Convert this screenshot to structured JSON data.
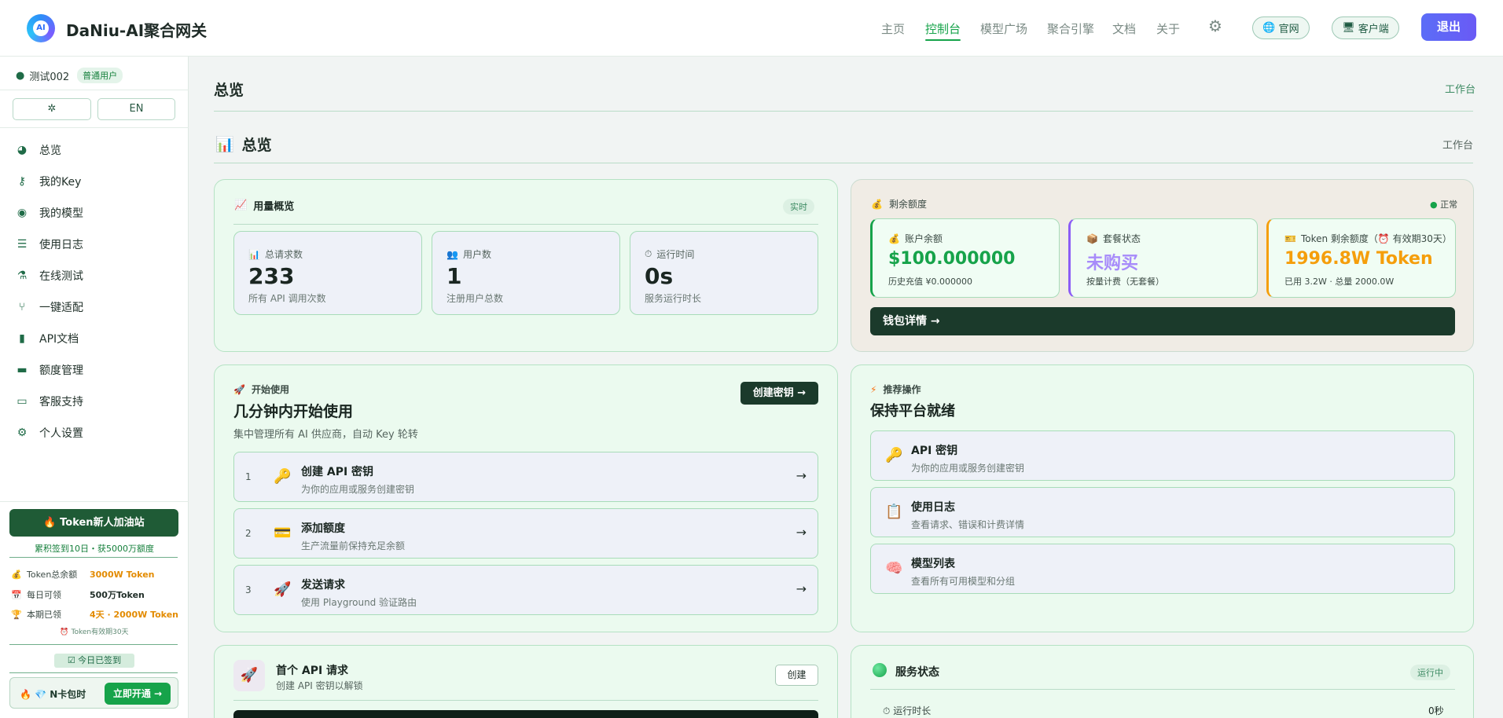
{
  "app": {
    "name": "DaNiu-AI聚合网关",
    "logo_text": "AI"
  },
  "nav": {
    "items": [
      {
        "label": "主页"
      },
      {
        "label": "控制台"
      },
      {
        "label": "模型广场"
      },
      {
        "label": "聚合引擎"
      },
      {
        "label": "文档"
      },
      {
        "label": "关于"
      }
    ],
    "active": "控制台",
    "official_site": "官网",
    "client": "客户端",
    "logout": "退出"
  },
  "sidebar": {
    "username": "测试002",
    "role_badge": "普通用户",
    "lang_button": "EN",
    "items": [
      {
        "label": "总览",
        "icon": "pie-chart-icon"
      },
      {
        "label": "我的Key",
        "icon": "key-icon"
      },
      {
        "label": "我的模型",
        "icon": "brain-icon"
      },
      {
        "label": "使用日志",
        "icon": "list-icon"
      },
      {
        "label": "在线测试",
        "icon": "flask-icon"
      },
      {
        "label": "一键适配",
        "icon": "branch-icon"
      },
      {
        "label": "API文档",
        "icon": "book-icon"
      },
      {
        "label": "额度管理",
        "icon": "wallet-icon"
      },
      {
        "label": "客服支持",
        "icon": "support-icon"
      },
      {
        "label": "个人设置",
        "icon": "gear-icon"
      }
    ],
    "promo": {
      "button": "Token新人加油站",
      "subtitle": "累积签到10日・获5000万额度",
      "rows": [
        {
          "key": "Token总余额",
          "value": "3000W Token",
          "color": "#e38b00"
        },
        {
          "key": "每日可领",
          "value": "500万Token",
          "color": "#1f2d27"
        },
        {
          "key": "本期已领",
          "value": "4天 · 2000W Token",
          "color": "#e38b00"
        }
      ],
      "note": "Token有效期30天",
      "checked_in": "今日已签到"
    },
    "ncard": {
      "label": "N卡包时",
      "button": "立即开通 →"
    }
  },
  "main": {
    "page_title": "总览",
    "breadcrumb": "工作台",
    "section_title": "总览",
    "section_breadcrumb": "工作台",
    "usage": {
      "title": "用量概览",
      "tag": "实时",
      "stats": [
        {
          "label": "总请求数",
          "value": "233",
          "sub": "所有 API 调用次数"
        },
        {
          "label": "用户数",
          "value": "1",
          "sub": "注册用户总数"
        },
        {
          "label": "运行时间",
          "value": "0s",
          "sub": "服务运行时长"
        }
      ]
    },
    "quota": {
      "title": "剩余额度",
      "status": "正常",
      "cards": [
        {
          "label": "账户余额",
          "value": "$100.000000",
          "sub": "历史充值 ¥0.000000",
          "color": "#16a34a"
        },
        {
          "label": "套餐状态",
          "value": "未购买",
          "sub": "按量计费（无套餐）",
          "color": "#a78bfa"
        },
        {
          "label": "Token 剩余额度（⏰ 有效期30天）",
          "value": "1996.8W Token",
          "sub": "已用 3.2W · 总量 2000.0W",
          "color": "#f59e0b"
        }
      ],
      "wallet_button": "钱包详情 →"
    },
    "getting_started": {
      "kicker": "开始使用",
      "title": "几分钟内开始使用",
      "subtitle": "集中管理所有 AI 供应商，自动 Key 轮转",
      "button": "创建密钥 →",
      "steps": [
        {
          "num": "1",
          "title": "创建 API 密钥",
          "sub": "为你的应用或服务创建密钥"
        },
        {
          "num": "2",
          "title": "添加额度",
          "sub": "生产流量前保持充足余额"
        },
        {
          "num": "3",
          "title": "发送请求",
          "sub": "使用 Playground 验证路由"
        }
      ]
    },
    "recommended": {
      "kicker": "推荐操作",
      "title": "保持平台就绪",
      "items": [
        {
          "title": "API 密钥",
          "sub": "为你的应用或服务创建密钥"
        },
        {
          "title": "使用日志",
          "sub": "查看请求、错误和计费详情"
        },
        {
          "title": "模型列表",
          "sub": "查看所有可用模型和分组"
        }
      ]
    },
    "first_request": {
      "title": "首个 API 请求",
      "sub": "创建 API 密钥以解锁",
      "button": "创建"
    },
    "service": {
      "title": "服务状态",
      "tag": "运行中",
      "row_label": "运行时长",
      "row_value": "0秒"
    }
  }
}
